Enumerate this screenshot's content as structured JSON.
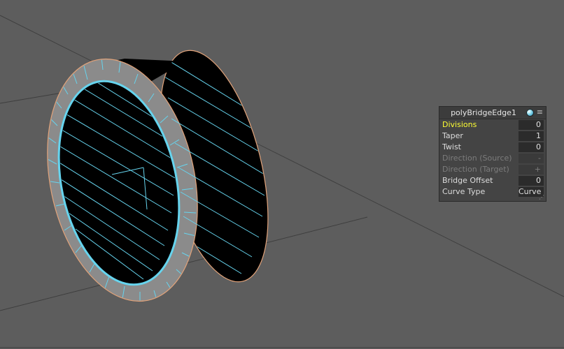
{
  "channel_box": {
    "node_name": "polyBridgeEdge1",
    "attributes": [
      {
        "label": "Divisions",
        "value": "0",
        "state": "selected"
      },
      {
        "label": "Taper",
        "value": "1",
        "state": "normal"
      },
      {
        "label": "Twist",
        "value": "0",
        "state": "normal"
      },
      {
        "label": "Direction (Source)",
        "value": "-",
        "state": "disabled"
      },
      {
        "label": "Direction (Target)",
        "value": "+",
        "state": "disabled"
      },
      {
        "label": "Bridge Offset",
        "value": "0",
        "state": "normal"
      },
      {
        "label": "Curve Type",
        "value": "Curve",
        "state": "normal"
      }
    ],
    "icons": {
      "node_state": "sphere-icon",
      "menu": "menu-icon",
      "resize": "resize-grip-icon"
    }
  },
  "colors": {
    "viewport_background": "#5d5d5d",
    "grid_line": "#3e3e3e",
    "mesh_fill": "#000000",
    "wireframe_highlight": "#66d4ee",
    "border_edge": "#e2a37a",
    "selected_attribute": "#ffff33",
    "ring_fill": "#8b8b8b"
  }
}
